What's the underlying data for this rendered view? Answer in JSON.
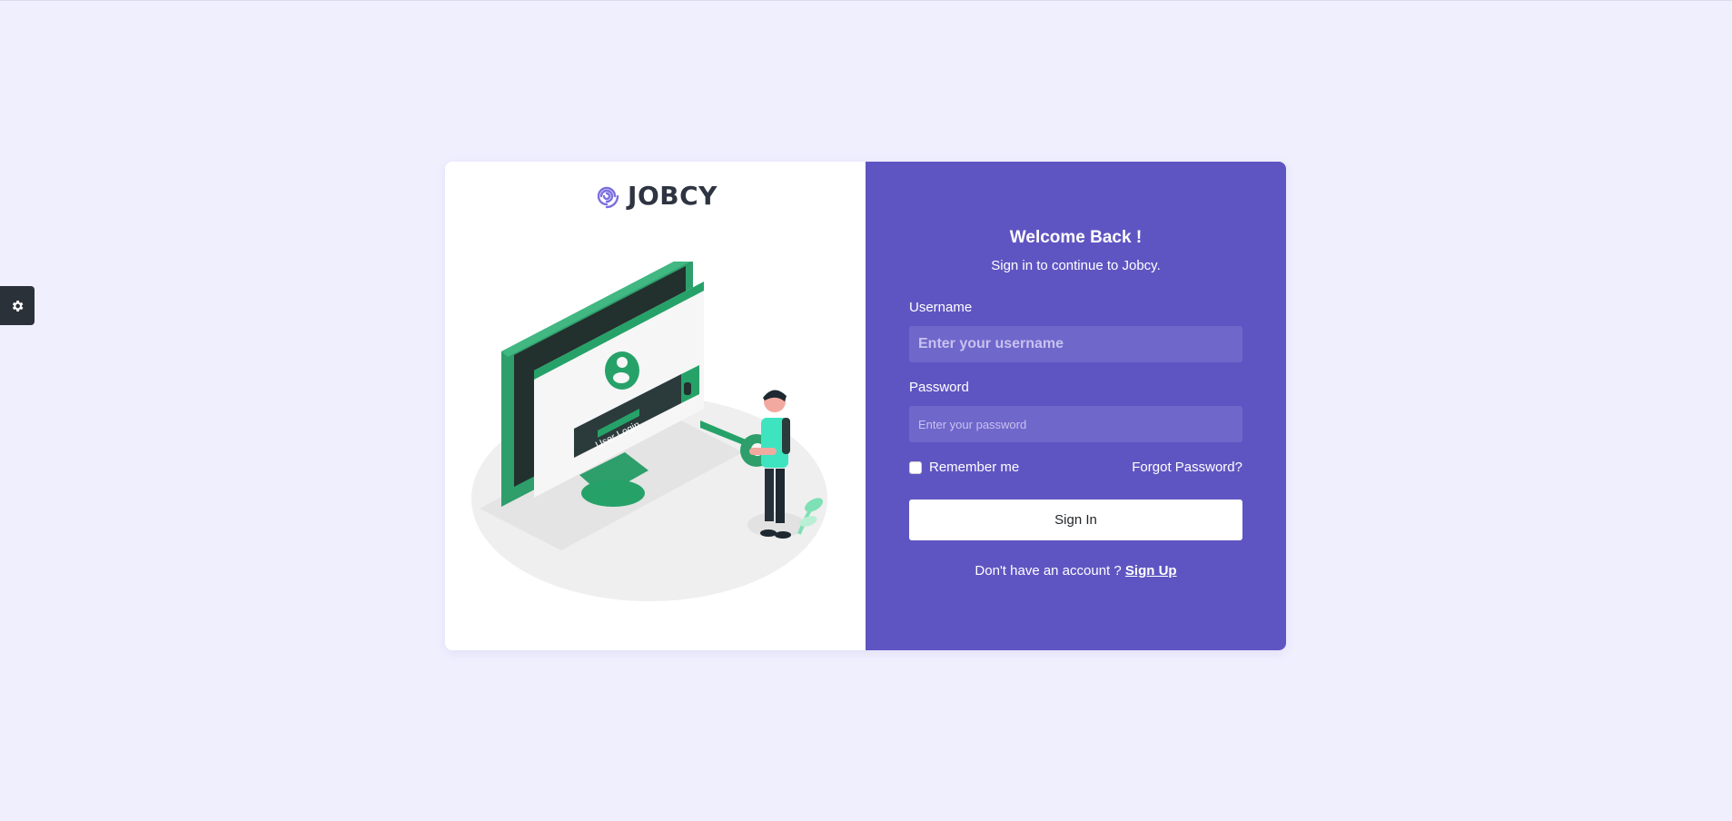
{
  "brand": {
    "name": "JOBCY",
    "accent": "#7c6fe0"
  },
  "illustration": {
    "screen_label": "User Login"
  },
  "login": {
    "title": "Welcome Back !",
    "subtitle": "Sign in to continue to Jobcy.",
    "username_label": "Username",
    "username_placeholder": "Enter your username",
    "password_label": "Password",
    "password_placeholder": "Enter your password",
    "remember_label": "Remember me",
    "forgot_label": "Forgot Password?",
    "submit_label": "Sign In",
    "signup_prompt": "Don't have an account ?",
    "signup_link": "Sign Up"
  },
  "colors": {
    "page_bg": "#f0effe",
    "panel_bg": "#5f55c2",
    "input_bg": "#7067cb",
    "illustration_green": "#26a269"
  },
  "icons": {
    "settings": "gear-icon",
    "logo": "spiral-logo-icon"
  }
}
